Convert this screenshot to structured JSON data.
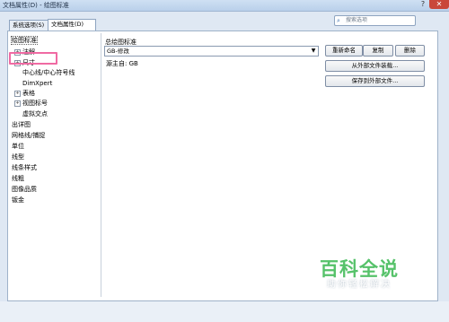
{
  "window": {
    "title": "文档属性(D) - 绘图标准",
    "help_glyph": "?",
    "close_glyph": "✕"
  },
  "tabs": [
    {
      "label": "系统选项(S)",
      "active": false
    },
    {
      "label": "文档属性(D)",
      "active": true
    }
  ],
  "search": {
    "placeholder": "搜索选项",
    "icon": "search-icon"
  },
  "tree": {
    "items": [
      {
        "label": "绘图标准",
        "expander": ""
      },
      {
        "label": "注解",
        "expander": "+"
      },
      {
        "label": "尺寸",
        "expander": "+"
      },
      {
        "label": "中心线/中心符号线",
        "expander": ""
      },
      {
        "label": "DimXpert",
        "expander": ""
      },
      {
        "label": "表格",
        "expander": "+"
      },
      {
        "label": "视图标号",
        "expander": "+"
      },
      {
        "label": "虚拟交点",
        "expander": ""
      },
      {
        "label": "出详图",
        "expander": ""
      },
      {
        "label": "网格线/捕捉",
        "expander": ""
      },
      {
        "label": "单位",
        "expander": ""
      },
      {
        "label": "线型",
        "expander": ""
      },
      {
        "label": "线条样式",
        "expander": ""
      },
      {
        "label": "线粗",
        "expander": ""
      },
      {
        "label": "图像品质",
        "expander": ""
      },
      {
        "label": "钣金",
        "expander": ""
      }
    ]
  },
  "main": {
    "overall_label": "总绘图标准",
    "standard_value": "GB-修改",
    "base_label": "源主自: GB",
    "buttons": {
      "rename": "重新命名",
      "copy": "复制",
      "delete": "删除",
      "load": "从外部文件装载...",
      "save": "保存到外部文件..."
    }
  },
  "watermark": {
    "title": "百科全说",
    "subtitle": "助你轻松解决"
  },
  "colors": {
    "highlight": "#f06aa3",
    "watermark_green": "#56c26a"
  }
}
